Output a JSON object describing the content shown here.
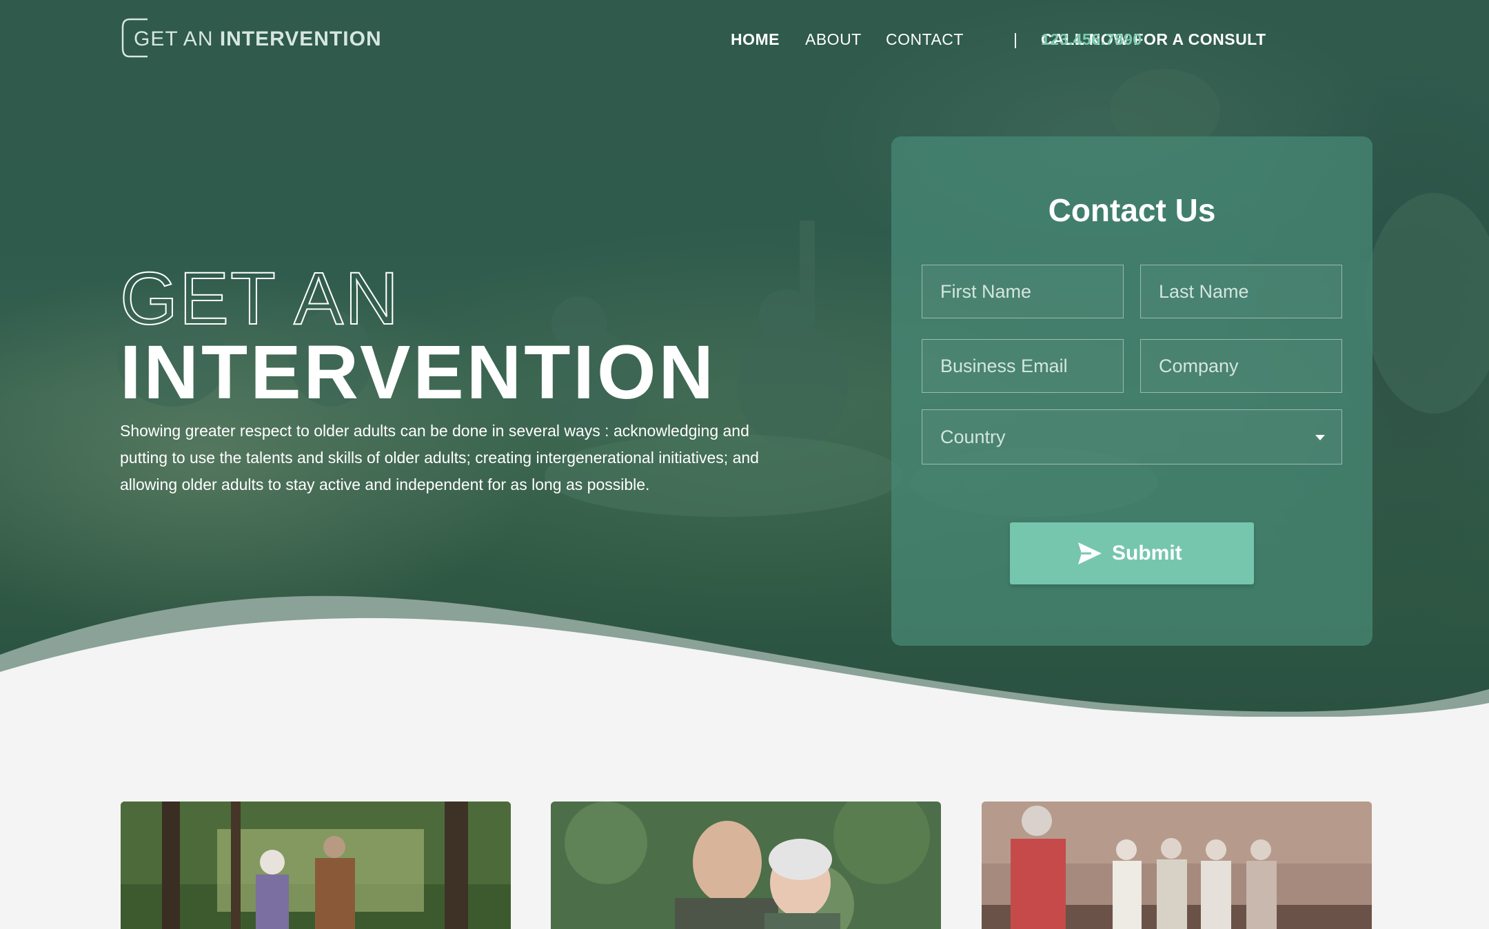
{
  "nav": {
    "logo": {
      "light": "GET AN",
      "bold": "INTERVENTION"
    },
    "items": [
      {
        "label": "HOME",
        "active": true
      },
      {
        "label": "ABOUT"
      },
      {
        "label": "CONTACT"
      }
    ],
    "separator": "|",
    "call_label": "CALL NOW FOR A CONSULT",
    "phone": "123.456.7890"
  },
  "hero": {
    "title_outline": "GET AN",
    "title_solid": "INTERVENTION",
    "description": "Showing greater respect to older adults can be done in several ways : acknowledging and putting to use the talents and skills of older adults; creating intergenerational initiatives; and allowing older adults to stay active and independent for as long as possible."
  },
  "contact_form": {
    "title": "Contact Us",
    "first_name_placeholder": "First Name",
    "last_name_placeholder": "Last Name",
    "email_placeholder": "Business Email",
    "company_placeholder": "Company",
    "country_value": "Country",
    "submit_label": "Submit"
  },
  "colors": {
    "accent": "#76c6ad",
    "phone": "#7cc9b0",
    "hero_overlay": "#2f5a4c",
    "card": "#46877399"
  },
  "icons": {
    "submit": "send-icon",
    "select": "caret-down-icon"
  },
  "photos": [
    {
      "name": "elderly-couple-walking-forest"
    },
    {
      "name": "smiling-elderly-couple"
    },
    {
      "name": "elderly-women-on-bench"
    }
  ]
}
